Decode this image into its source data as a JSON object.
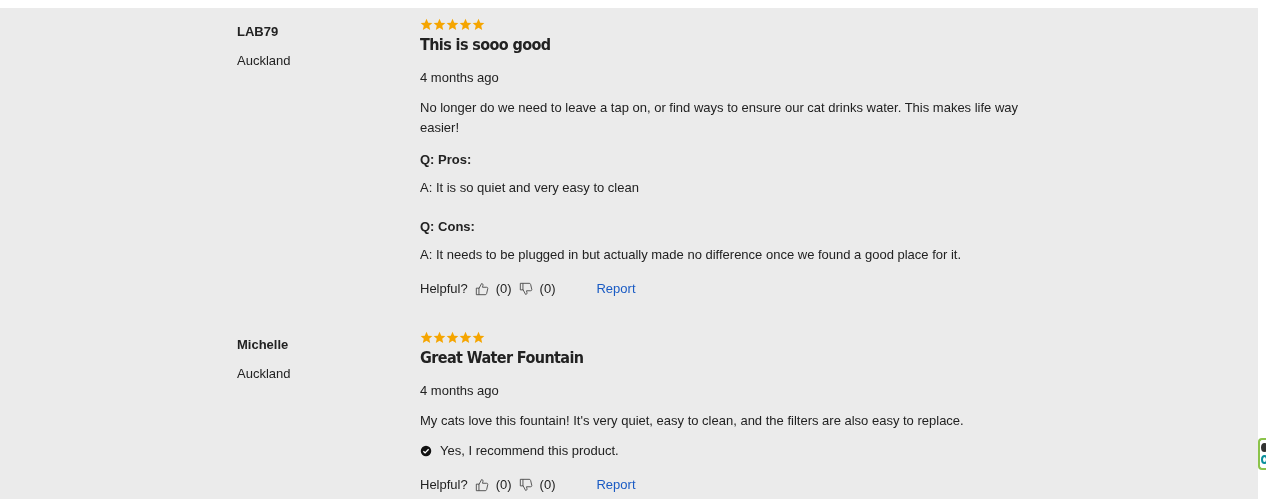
{
  "reviews": [
    {
      "author": "LAB79",
      "location": "Auckland",
      "stars": 5,
      "title": "This is sooo good",
      "date": "4 months ago",
      "body": "No longer do we need to leave a tap on, or find ways to ensure our cat drinks water. This makes life way easier!",
      "qa": [
        {
          "question": "Q: Pros:",
          "answer": "A: It is so quiet and very easy to clean"
        },
        {
          "question": "Q: Cons:",
          "answer": "A: It needs to be plugged in but actually made no difference once we found a good place for it."
        }
      ],
      "helpful": {
        "label": "Helpful?",
        "up": "(0)",
        "down": "(0)"
      },
      "report": "Report"
    },
    {
      "author": "Michelle",
      "location": "Auckland",
      "stars": 5,
      "title": "Great Water Fountain",
      "date": "4 months ago",
      "body": "My cats love this fountain! It's very quiet, easy to clean, and the filters are also easy to replace.",
      "recommend": "Yes, I recommend this product.",
      "helpful": {
        "label": "Helpful?",
        "up": "(0)",
        "down": "(0)"
      },
      "report": "Report"
    }
  ]
}
